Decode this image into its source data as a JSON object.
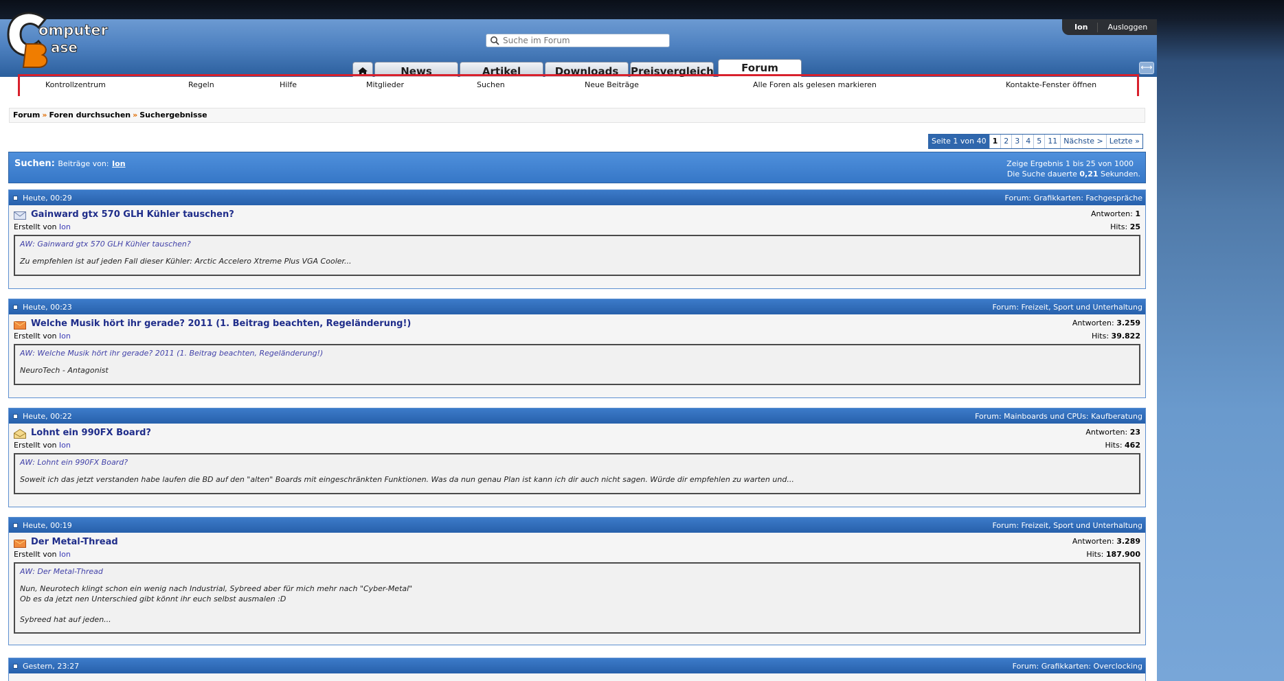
{
  "header": {
    "logo_text": "ComputerBase",
    "search_placeholder": "Suche im Forum",
    "user": {
      "name": "Ion",
      "logout": "Ausloggen"
    }
  },
  "tabs": [
    {
      "label": "News"
    },
    {
      "label": "Artikel"
    },
    {
      "label": "Downloads"
    },
    {
      "label": "Preisvergleich"
    },
    {
      "label": "Forum",
      "active": true
    }
  ],
  "nav": [
    "Kontrollzentrum",
    "Regeln",
    "Hilfe",
    "Mitglieder",
    "Suchen",
    "Neue Beiträge",
    "Alle Foren als gelesen markieren",
    "Kontakte-Fenster öffnen"
  ],
  "breadcrumb": [
    "Forum",
    "Foren durchsuchen",
    "Suchergebnisse"
  ],
  "pagination": {
    "label": "Seite 1 von 40",
    "pages": [
      "1",
      "2",
      "3",
      "4",
      "5",
      "11"
    ],
    "current": "1",
    "next": "Nächste >",
    "last": "Letzte »"
  },
  "search": {
    "title": "Suchen:",
    "sub": "Beiträge von:",
    "user": "Ion",
    "results_line": "Zeige Ergebnis 1 bis 25 von 1000",
    "duration_pre": "Die Suche dauerte",
    "duration": "0,21",
    "duration_post": "Sekunden."
  },
  "results": [
    {
      "date": "Heute, 00:29",
      "forum": "Forum: Grafikkarten: Fachgespräche",
      "title": "Gainward gtx 570 GLH Kühler tauschen?",
      "created_by": "Erstellt von",
      "user": "Ion",
      "replies_label": "Antworten:",
      "replies": "1",
      "hits_label": "Hits:",
      "hits": "25",
      "icon": "envelope-icon",
      "quote_title": "AW: Gainward gtx 570 GLH Kühler tauschen?",
      "quote_lines": [
        "Zu empfehlen ist auf jeden Fall dieser Kühler: Arctic Accelero Xtreme Plus VGA Cooler..."
      ]
    },
    {
      "date": "Heute, 00:23",
      "forum": "Forum: Freizeit, Sport und Unterhaltung",
      "title": "Welche Musik hört ihr gerade? 2011 (1. Beitrag beachten, Regeländerung!)",
      "created_by": "Erstellt von",
      "user": "Ion",
      "replies_label": "Antworten:",
      "replies": "3.259",
      "hits_label": "Hits:",
      "hits": "39.822",
      "icon": "hot-folder-icon",
      "quote_title": "AW: Welche Musik hört ihr gerade? 2011 (1. Beitrag beachten, Regeländerung!)",
      "quote_lines": [
        "NeuroTech - Antagonist"
      ]
    },
    {
      "date": "Heute, 00:22",
      "forum": "Forum: Mainboards und CPUs: Kaufberatung",
      "title": "Lohnt ein 990FX Board?",
      "created_by": "Erstellt von",
      "user": "Ion",
      "replies_label": "Antworten:",
      "replies": "23",
      "hits_label": "Hits:",
      "hits": "462",
      "icon": "open-envelope-icon",
      "quote_title": "AW: Lohnt ein 990FX Board?",
      "quote_lines": [
        "Soweit ich das jetzt verstanden habe laufen die BD auf den \"alten\" Boards mit eingeschränkten Funktionen. Was da nun genau Plan ist kann ich dir auch nicht sagen. Würde dir empfehlen zu warten und..."
      ]
    },
    {
      "date": "Heute, 00:19",
      "forum": "Forum: Freizeit, Sport und Unterhaltung",
      "title": "Der Metal-Thread",
      "created_by": "Erstellt von",
      "user": "Ion",
      "replies_label": "Antworten:",
      "replies": "3.289",
      "hits_label": "Hits:",
      "hits": "187.900",
      "icon": "hot-folder-icon",
      "quote_title": "AW: Der Metal-Thread",
      "quote_lines": [
        "Nun, Neurotech klingt schon ein wenig nach Industrial, Sybreed aber für mich mehr nach \"Cyber-Metal\"",
        "Ob es da jetzt nen Unterschied gibt könnt ihr euch selbst ausmalen :D",
        "",
        "Sybreed hat auf jeden..."
      ]
    },
    {
      "date": "Gestern, 23:27",
      "forum": "Forum: Grafikkarten: Overclocking"
    }
  ]
}
